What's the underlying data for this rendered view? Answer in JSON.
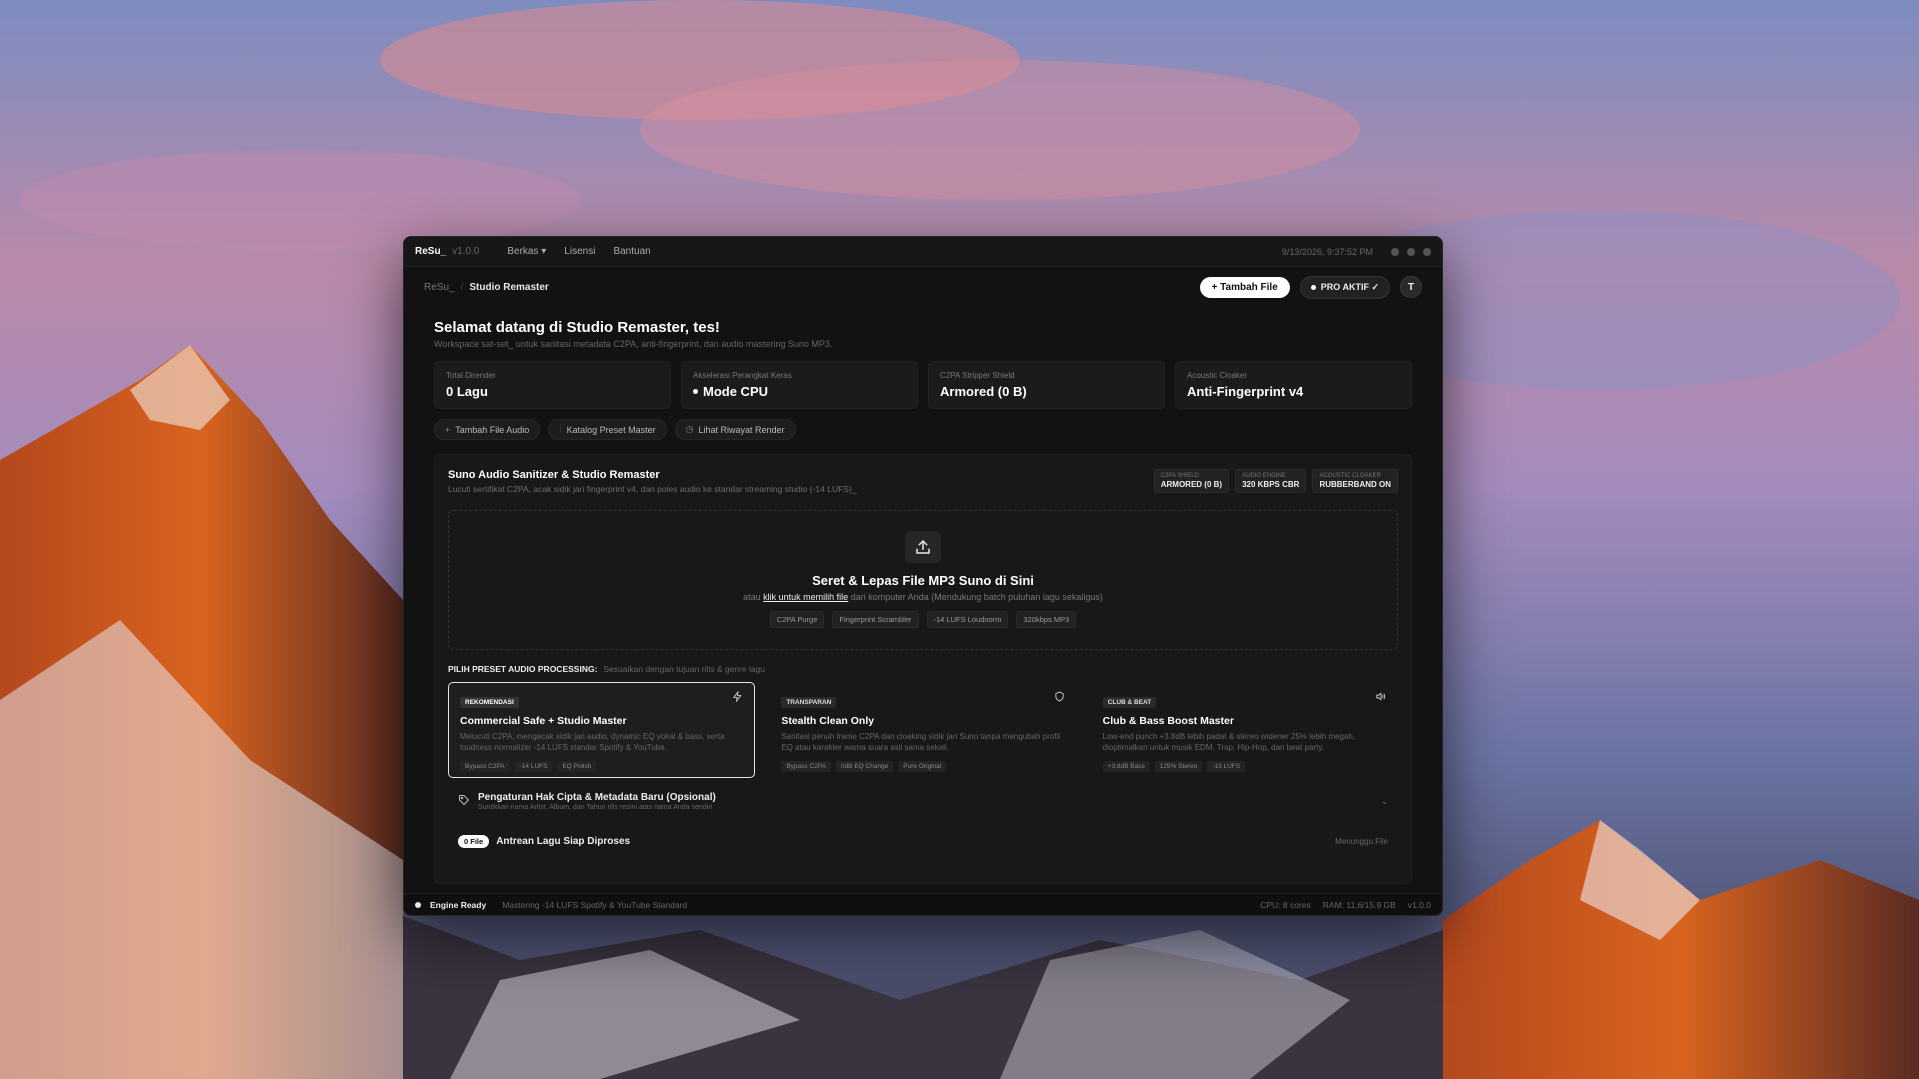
{
  "titlebar": {
    "app_name": "ReSu_",
    "version": "v1.0.0",
    "menu": [
      "Berkas ▾",
      "Lisensi",
      "Bantuan"
    ],
    "datetime": "9/13/2026, 9:37:52 PM"
  },
  "topbar": {
    "breadcrumb_root": "ReSu_",
    "breadcrumb_current": "Studio Remaster",
    "add_file_label": "+ Tambah File",
    "pro_label": "PRO AKTIF ✓",
    "avatar_initial": "T"
  },
  "header": {
    "welcome": "Selamat datang di Studio Remaster, tes!",
    "subtitle": "Workspace sat-set_ untuk sanitasi metadata C2PA, anti-fingerprint, dan audio mastering Suno MP3."
  },
  "stats": [
    {
      "label": "Total Dirender",
      "value": "0 Lagu"
    },
    {
      "label": "Akselerasi Perangkat Keras",
      "value": "Mode CPU"
    },
    {
      "label": "C2PA Stripper Shield",
      "value": "Armored (0 B)"
    },
    {
      "label": "Acoustic Cloaker",
      "value": "Anti-Fingerprint v4"
    }
  ],
  "actions": [
    {
      "icon": "+",
      "label": "Tambah File Audio"
    },
    {
      "icon": "⫶",
      "label": "Katalog Preset Master"
    },
    {
      "icon": "◷",
      "label": "Lihat Riwayat Render"
    }
  ],
  "panel": {
    "title": "Suno Audio Sanitizer & Studio Remaster",
    "subtitle": "Lucuti sertifikat C2PA, acak sidik jari fingerprint v4, dan poles audio ke standar streaming studio (-14 LUFS)_",
    "badges": [
      {
        "label": "C2PA SHIELD",
        "value": "ARMORED (0 B)"
      },
      {
        "label": "AUDIO ENGINE",
        "value": "320 KBPS CBR"
      },
      {
        "label": "ACOUSTIC CLOAKER",
        "value": "RUBBERBAND ON"
      }
    ]
  },
  "dropzone": {
    "title": "Seret & Lepas File MP3 Suno di Sini",
    "prefix": "atau",
    "link": "klik untuk memilih file",
    "suffix": "dari komputer Anda (Mendukung batch puluhan lagu sekaligus)",
    "tags": [
      "C2PA Purge",
      "Fingerprint Scrambler",
      "-14 LUFS Loudnorm",
      "320kbps MP3"
    ]
  },
  "presets": {
    "heading": "PILIH PRESET AUDIO PROCESSING:",
    "hint": "Sesuaikan dengan tujuan rilis & genre lagu",
    "items": [
      {
        "badge": "REKOMENDASI",
        "icon": "bolt-icon",
        "title": "Commercial Safe + Studio Master",
        "desc": "Melucuti C2PA, mengacak sidik jari audio, dynamic EQ vokal & bass, serta loudness normalizer -14 LUFS standar Spotify & YouTube.",
        "tags": [
          "Bypass C2PA",
          "-14 LUFS",
          "EQ Polish"
        ]
      },
      {
        "badge": "TRANSPARAN",
        "icon": "shield-icon",
        "title": "Stealth Clean Only",
        "desc": "Sanitasi penuh frame C2PA dan cloaking sidik jari Suno tanpa mengubah profil EQ atau karakter warna suara asli sama sekali.",
        "tags": [
          "Bypass C2PA",
          "0dB EQ Change",
          "Pure Original"
        ]
      },
      {
        "badge": "CLUB & BEAT",
        "icon": "speaker-icon",
        "title": "Club & Bass Boost Master",
        "desc": "Low-end punch +3.8dB lebih padat & stereo widener 25% lebih megah, dioptimalkan untuk musik EDM, Trap, Hip-Hop, dan beat party.",
        "tags": [
          "+3.8dB Bass",
          "125% Stereo",
          "-13 LUFS"
        ]
      }
    ]
  },
  "metadata": {
    "title": "Pengaturan Hak Cipta & Metadata Baru (Opsional)",
    "subtitle": "Suntikkan nama Artist, Album, dan Tahun rilis resmi atas nama Anda sendiri"
  },
  "queue": {
    "count": "0 File",
    "title": "Antrean Lagu Siap Diproses",
    "status": "Menunggu File"
  },
  "statusbar": {
    "state": "Engine Ready",
    "mode": "Mastering -14 LUFS Spotify & YouTube Standard",
    "cpu": "CPU: 8 cores",
    "ram": "RAM: 11.6/15.9 GB",
    "version": "v1.0.0"
  }
}
